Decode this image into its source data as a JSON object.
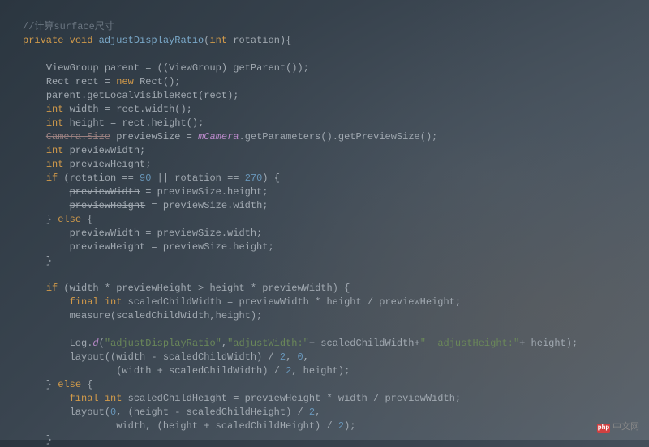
{
  "code": {
    "l1_comment": "//计算surface尺寸",
    "l2_kw1": "private",
    "l2_kw2": "void",
    "l2_method": "adjustDisplayRatio",
    "l2_kw3": "int",
    "l2_param": "rotation",
    "l4_type": "ViewGroup",
    "l4_var": "parent",
    "l4_cast": "ViewGroup",
    "l4_call": "getParent",
    "l5_type": "Rect",
    "l5_var": "rect",
    "l5_new": "new",
    "l5_ctor": "Rect",
    "l6_obj": "parent",
    "l6_method": "getLocalVisibleRect",
    "l6_arg": "rect",
    "l7_kw": "int",
    "l7_var": "width",
    "l7_obj": "rect",
    "l7_method": "width",
    "l8_kw": "int",
    "l8_var": "height",
    "l8_obj": "rect",
    "l8_method": "height",
    "l9_strike": "Camera.Size",
    "l9_var": "previewSize",
    "l9_field": "mCamera",
    "l9_m1": "getParameters",
    "l9_m2": "getPreviewSize",
    "l10_kw": "int",
    "l10_var": "previewWidth",
    "l11_kw": "int",
    "l11_var": "previewHeight",
    "l12_if": "if",
    "l12_var1": "rotation",
    "l12_n1": "90",
    "l12_var2": "rotation",
    "l12_n2": "270",
    "l13_strike": "previewWidth",
    "l13_rhs": "previewSize.height",
    "l14_strike": "previewHeight",
    "l14_rhs": "previewSize.width",
    "l15_else": "else",
    "l16": "previewWidth = previewSize.width;",
    "l17": "previewHeight = previewSize.height;",
    "l20_if": "if",
    "l20_cond": "(width * previewHeight > height * previewWidth) {",
    "l21_kw": "final int",
    "l21_var": "scaledChildWidth",
    "l21_rhs": "= previewWidth * height / previewHeight;",
    "l22": "measure(scaledChildWidth,height);",
    "l24_log": "Log",
    "l24_d": "d",
    "l24_s1": "\"adjustDisplayRatio\"",
    "l24_s2": "\"adjustWidth:\"",
    "l24_mid": "+ scaledChildWidth+",
    "l24_s3": "\"  adjustHeight:\"",
    "l24_end": "+ height);",
    "l25": "layout((width - scaledChildWidth) / ",
    "l25_n1": "2",
    "l25_mid": ", ",
    "l25_n2": "0",
    "l25_end": ",",
    "l26_pre": "        (width + scaledChildWidth) / ",
    "l26_n": "2",
    "l26_end": ", height);",
    "l27_else": "else",
    "l28_kw": "final int",
    "l28_var": "scaledChildHeight",
    "l28_rhs": "= previewHeight * width / previewWidth;",
    "l29_pre": "layout(",
    "l29_n1": "0",
    "l29_mid1": ", (height - scaledChildHeight) / ",
    "l29_n2": "2",
    "l29_end": ",",
    "l30_pre": "        width, (height + scaledChildHeight) / ",
    "l30_n": "2",
    "l30_end": ");"
  },
  "badge": {
    "icon": "php",
    "text": "中文网"
  }
}
